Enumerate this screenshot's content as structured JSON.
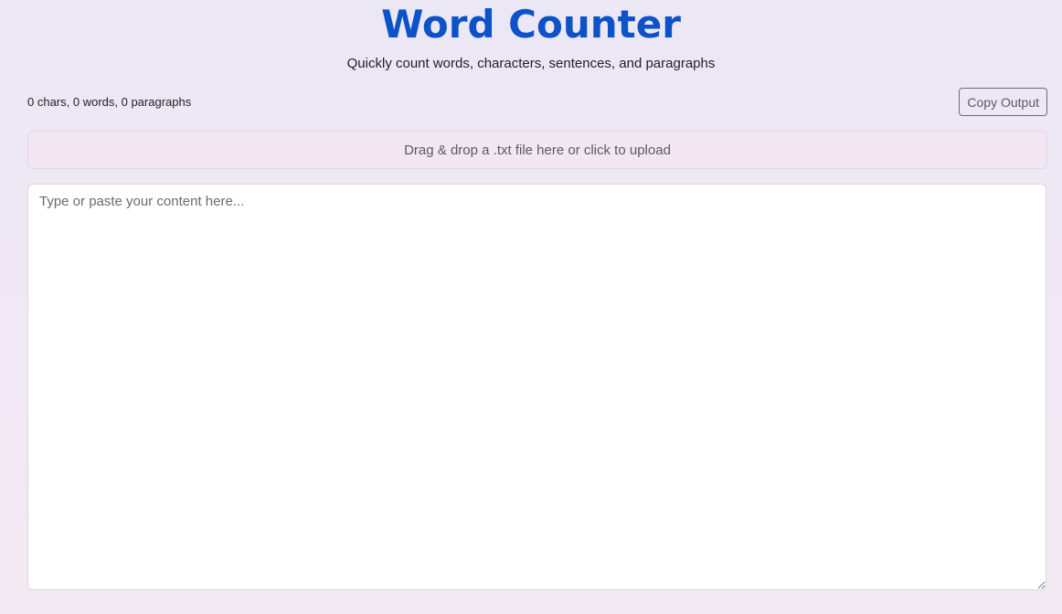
{
  "header": {
    "title": "Word Counter",
    "subtitle": "Quickly count words, characters, sentences, and paragraphs"
  },
  "stats": {
    "summary": "0 chars, 0 words, 0 paragraphs"
  },
  "toolbar": {
    "copy_label": "Copy Output"
  },
  "dropzone": {
    "label": "Drag & drop a .txt file here or click to upload"
  },
  "editor": {
    "value": "",
    "placeholder": "Type or paste your content here..."
  },
  "colors": {
    "accent": "#0d52c9"
  }
}
